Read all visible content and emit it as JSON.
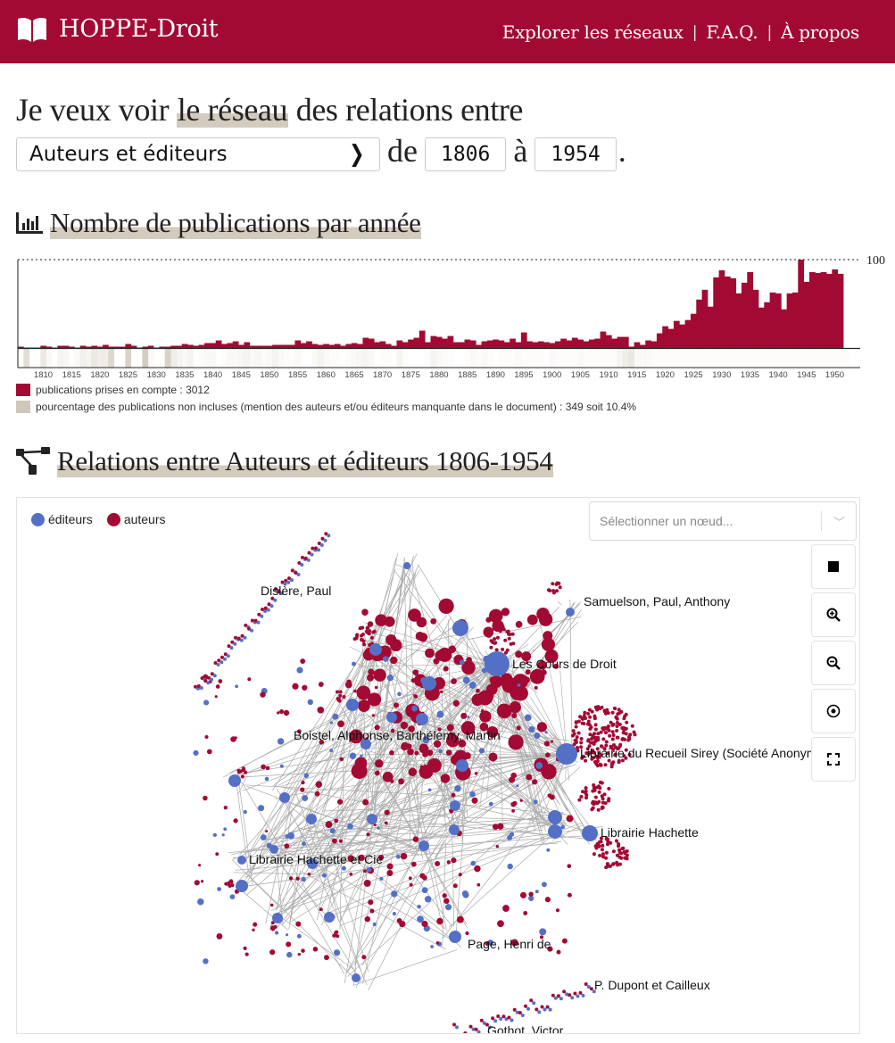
{
  "header": {
    "brand": "HOPPE-Droit",
    "nav": [
      {
        "label": "Explorer les réseaux"
      },
      {
        "label": "F.A.Q."
      },
      {
        "label": "À propos"
      }
    ],
    "separator": "|",
    "colors": {
      "brand": "#a20a33"
    }
  },
  "query": {
    "prefix": "Je veux voir",
    "highlight": "le réseau",
    "suffix": "des relations entre",
    "relation_select": "Auteurs et éditeurs",
    "from_word": "de",
    "from_year": "1806",
    "to_word": "à",
    "to_year": "1954",
    "period": "."
  },
  "pub_section": {
    "title": "Nombre de publications par année",
    "legend_included": "publications prises en compte : 3012",
    "legend_missing": "pourcentage des publications non incluses (mention des auteurs et/ou éditeurs manquante dans le document) : 349 soit 10.4%"
  },
  "chart_data": {
    "type": "bar",
    "title": "Nombre de publications par année",
    "xlabel": "",
    "ylabel": "",
    "x_start": 1806,
    "x_end": 1954,
    "ylim": [
      0,
      100
    ],
    "max_label": "100",
    "x_ticks": [
      "1810",
      "1815",
      "1820",
      "1825",
      "1830",
      "1835",
      "1840",
      "1845",
      "1850",
      "1855",
      "1860",
      "1865",
      "1870",
      "1875",
      "1880",
      "1885",
      "1890",
      "1895",
      "1900",
      "1905",
      "1910",
      "1915",
      "1920",
      "1925",
      "1930",
      "1935",
      "1940",
      "1945",
      "1950"
    ],
    "colors": {
      "included": "#a20a33",
      "missing": "#cfc8b8"
    },
    "series": [
      {
        "name": "publications prises en compte",
        "values": [
          2,
          1,
          1,
          1,
          3,
          2,
          1,
          3,
          3,
          2,
          1,
          3,
          2,
          3,
          2,
          4,
          2,
          2,
          2,
          5,
          3,
          1,
          2,
          3,
          1,
          2,
          2,
          3,
          3,
          5,
          4,
          3,
          4,
          6,
          6,
          9,
          5,
          6,
          8,
          4,
          7,
          3,
          3,
          3,
          3,
          4,
          4,
          4,
          4,
          9,
          6,
          8,
          5,
          4,
          5,
          4,
          5,
          3,
          5,
          6,
          5,
          12,
          11,
          7,
          8,
          5,
          3,
          9,
          7,
          10,
          12,
          20,
          7,
          14,
          13,
          11,
          14,
          7,
          7,
          10,
          9,
          4,
          8,
          9,
          10,
          9,
          7,
          11,
          7,
          18,
          8,
          7,
          8,
          7,
          6,
          8,
          11,
          9,
          12,
          10,
          8,
          10,
          11,
          19,
          15,
          11,
          13,
          13,
          2,
          7,
          4,
          9,
          8,
          17,
          25,
          22,
          31,
          27,
          32,
          39,
          55,
          66,
          47,
          80,
          88,
          81,
          79,
          62,
          74,
          86,
          66,
          46,
          52,
          63,
          62,
          44,
          62,
          63,
          100,
          75,
          86,
          85,
          86,
          84,
          89,
          84
        ],
        "note": "approximate, read from bar heights"
      },
      {
        "name": "pourcentage des publications non incluses",
        "values": [
          0,
          60,
          0,
          0,
          40,
          10,
          0,
          20,
          15,
          0,
          10,
          25,
          20,
          40,
          30,
          30,
          70,
          0,
          0,
          80,
          0,
          0,
          90,
          10,
          0,
          0,
          80,
          30,
          20,
          10,
          20,
          0,
          5,
          10,
          10,
          0,
          5,
          10,
          10,
          15,
          20,
          10,
          15,
          5,
          10,
          20,
          10,
          5,
          5,
          10,
          0,
          0,
          10,
          20,
          10,
          5,
          5,
          0,
          5,
          10,
          15,
          20,
          10,
          0,
          5,
          5,
          0,
          20,
          5,
          0,
          0,
          0,
          5,
          20,
          10,
          5,
          5,
          0,
          0,
          5,
          10,
          5,
          10,
          5,
          0,
          5,
          5,
          5,
          10,
          5,
          5,
          5,
          5,
          0,
          10,
          5,
          5,
          5,
          5,
          10,
          5,
          5,
          5,
          5,
          5,
          5,
          20,
          30,
          40,
          10,
          10,
          10,
          5,
          5,
          5,
          5,
          5,
          5,
          5,
          5,
          5,
          5,
          5,
          5,
          5,
          5,
          5,
          5,
          5,
          5,
          5,
          5,
          5,
          5,
          5,
          5,
          5,
          5,
          5,
          5,
          5,
          5,
          5,
          5,
          5,
          5,
          5
        ],
        "note": "approximate shading intensity"
      }
    ]
  },
  "network_section": {
    "title": "Relations entre Auteurs et éditeurs 1806-1954",
    "legend": [
      {
        "label": "éditeurs",
        "color": "#5470c6"
      },
      {
        "label": "auteurs",
        "color": "#a20a33"
      }
    ],
    "node_select_placeholder": "Sélectionner un nœud...",
    "controls": [
      {
        "name": "stop-layout",
        "icon": "stop-icon"
      },
      {
        "name": "zoom-in",
        "icon": "zoom-in-icon"
      },
      {
        "name": "zoom-out",
        "icon": "zoom-out-icon"
      },
      {
        "name": "center",
        "icon": "target-icon"
      },
      {
        "name": "fullscreen",
        "icon": "fullscreen-icon"
      }
    ],
    "node_labels": [
      "Dislère, Paul",
      "Samuelson, Paul, Anthony",
      "Les Cours de Droit",
      "Boistel, Alphonse, Barthélemy, Martin",
      "Librairie du Recueil Sirey  (Société Anonyme)",
      "Librairie Hachette",
      "Librairie Hachette et Cie",
      "Page, Henri de",
      "P. Dupont et Cailleux",
      "Gothot, Victor"
    ]
  }
}
